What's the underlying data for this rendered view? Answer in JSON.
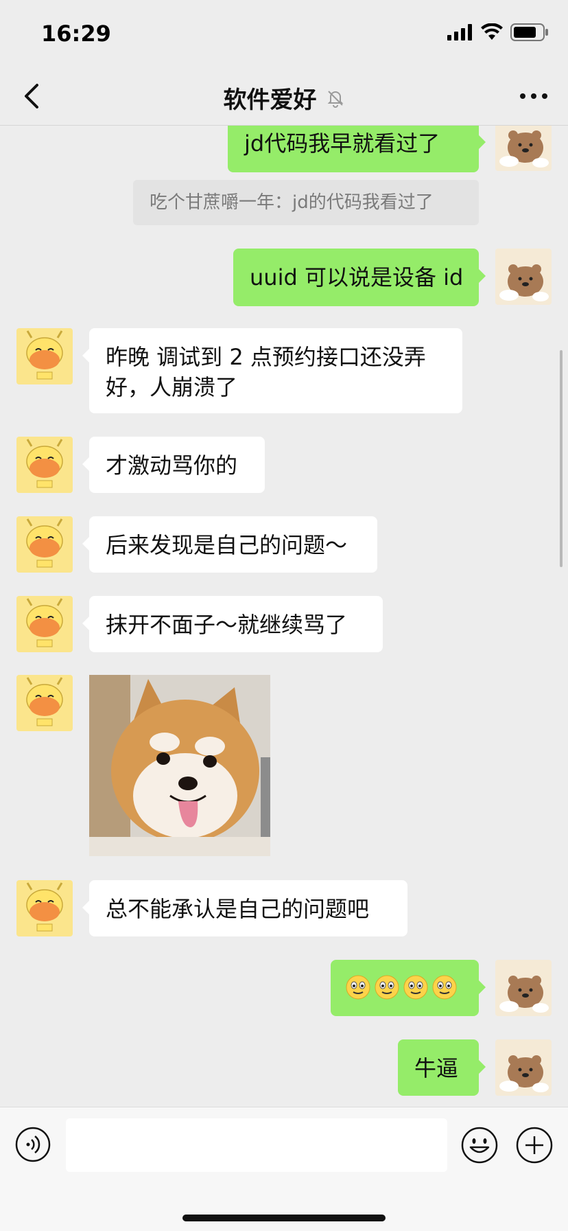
{
  "status_bar": {
    "time": "16:29",
    "signal_icon": "signal-icon",
    "wifi_icon": "wifi-icon",
    "battery_icon": "battery-icon"
  },
  "header": {
    "title": "软件爱好",
    "back_icon": "chevron-left-icon",
    "mute_icon": "bell-slash-icon",
    "more_icon": "more-dots-icon"
  },
  "messages": [
    {
      "side": "right",
      "text": "jd代码我早就看过了"
    },
    {
      "type": "quote",
      "text": "吃个甘蔗嚼一年：jd的代码我看过了"
    },
    {
      "side": "right",
      "text": "uuid 可以说是设备 id"
    },
    {
      "side": "left",
      "line1": "昨晚  调试到 2 点预约接口还没弄",
      "line2": "好，人崩溃了"
    },
    {
      "side": "left",
      "text": "才激动骂你的"
    },
    {
      "side": "left",
      "text": "后来发现是自己的问题～"
    },
    {
      "side": "left",
      "text": "抹开不面子～就继续骂了"
    },
    {
      "side": "left",
      "type": "image",
      "subject": "shiba-dog-sticker"
    },
    {
      "side": "left",
      "text": "总不能承认是自己的问题吧"
    },
    {
      "side": "right",
      "type": "emoji",
      "emoji": "smiley-icon",
      "count": 4
    },
    {
      "side": "right",
      "text": "牛逼"
    }
  ],
  "input_bar": {
    "placeholder": "",
    "voice_icon": "voice-icon",
    "emoji_icon": "emoji-icon",
    "plus_icon": "plus-circle-icon"
  },
  "colors": {
    "background": "#ededed",
    "bubble_self": "#95ec69",
    "bubble_other": "#ffffff",
    "quote_bg": "#e3e3e3"
  }
}
